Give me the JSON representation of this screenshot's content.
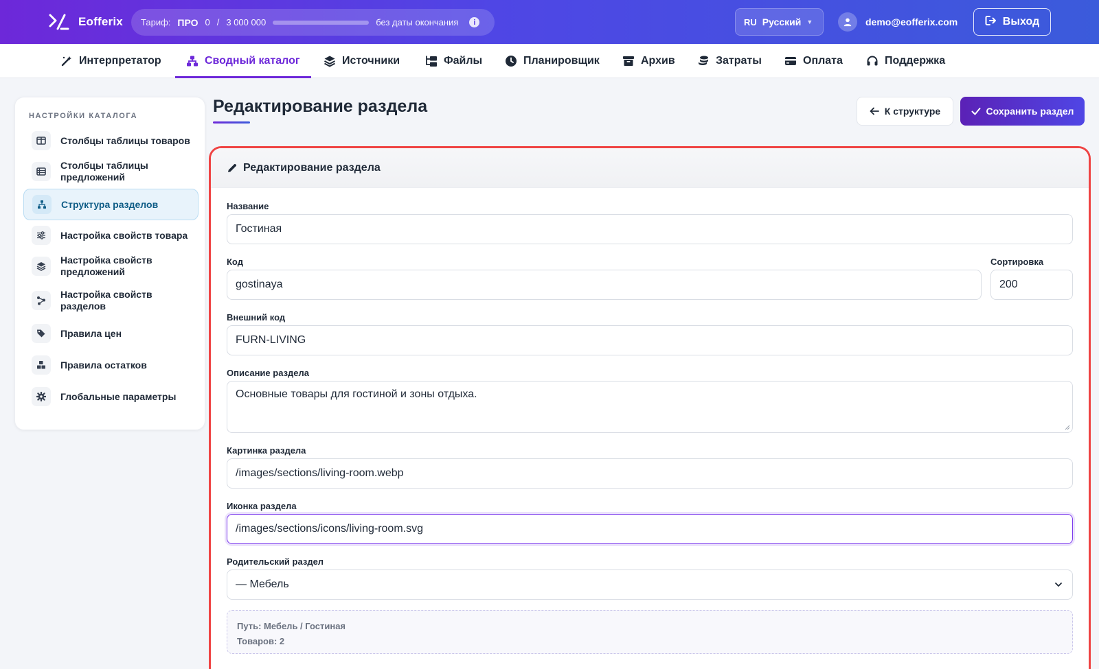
{
  "app": {
    "name": "Eofferix"
  },
  "plan": {
    "label": "Тариф:",
    "tier": "ПРО",
    "used": "0",
    "separator": "/",
    "limit": "3 000 000",
    "usage_fraction": 0,
    "expiry": "без даты окончания"
  },
  "language": {
    "code": "RU",
    "name": "Русский"
  },
  "user": {
    "email": "demo@eofferix.com"
  },
  "logout_label": "Выход",
  "nav": {
    "items": [
      {
        "label": "Интерпретатор",
        "icon": "magic-wand-icon"
      },
      {
        "label": "Сводный каталог",
        "icon": "sitemap-icon",
        "active": true
      },
      {
        "label": "Источники",
        "icon": "layers-icon"
      },
      {
        "label": "Файлы",
        "icon": "folder-tree-icon"
      },
      {
        "label": "Планировщик",
        "icon": "clock-icon"
      },
      {
        "label": "Архив",
        "icon": "archive-icon"
      },
      {
        "label": "Затраты",
        "icon": "coins-icon"
      },
      {
        "label": "Оплата",
        "icon": "credit-card-icon"
      },
      {
        "label": "Поддержка",
        "icon": "headset-icon"
      }
    ]
  },
  "sidebar": {
    "title": "НАСТРОЙКИ КАТАЛОГА",
    "items": [
      {
        "label": "Столбцы таблицы товаров",
        "icon": "table-columns-icon"
      },
      {
        "label": "Столбцы таблицы предложений",
        "icon": "table-list-icon"
      },
      {
        "label": "Структура разделов",
        "icon": "sitemap-icon",
        "active": true
      },
      {
        "label": "Настройка свойств товара",
        "icon": "sliders-icon"
      },
      {
        "label": "Настройка свойств предложений",
        "icon": "layers-icon"
      },
      {
        "label": "Настройка свойств разделов",
        "icon": "share-nodes-icon"
      },
      {
        "label": "Правила цен",
        "icon": "tags-icon"
      },
      {
        "label": "Правила остатков",
        "icon": "boxes-icon"
      },
      {
        "label": "Глобальные параметры",
        "icon": "gear-icon"
      }
    ]
  },
  "page": {
    "title": "Редактирование раздела",
    "back_label": "К структуре",
    "save_label": "Сохранить раздел"
  },
  "form": {
    "header": "Редактирование раздела",
    "name_label": "Название",
    "name_value": "Гостиная",
    "code_label": "Код",
    "code_value": "gostinaya",
    "sort_label": "Сортировка",
    "sort_value": "200",
    "ext_code_label": "Внешний код",
    "ext_code_value": "FURN-LIVING",
    "description_label": "Описание раздела",
    "description_value": "Основные товары для гостиной и зоны отдыха.",
    "image_label": "Картинка раздела",
    "image_value": "/images/sections/living-room.webp",
    "icon_label": "Иконка раздела",
    "icon_value": "/images/sections/icons/living-room.svg",
    "parent_label": "Родительский раздел",
    "parent_value": "— Мебель",
    "path_text": "Путь: Мебель / Гостиная",
    "products_text": "Товаров: 2"
  },
  "colors": {
    "accent": "#6d28d9",
    "highlight_border": "#ef4444"
  }
}
